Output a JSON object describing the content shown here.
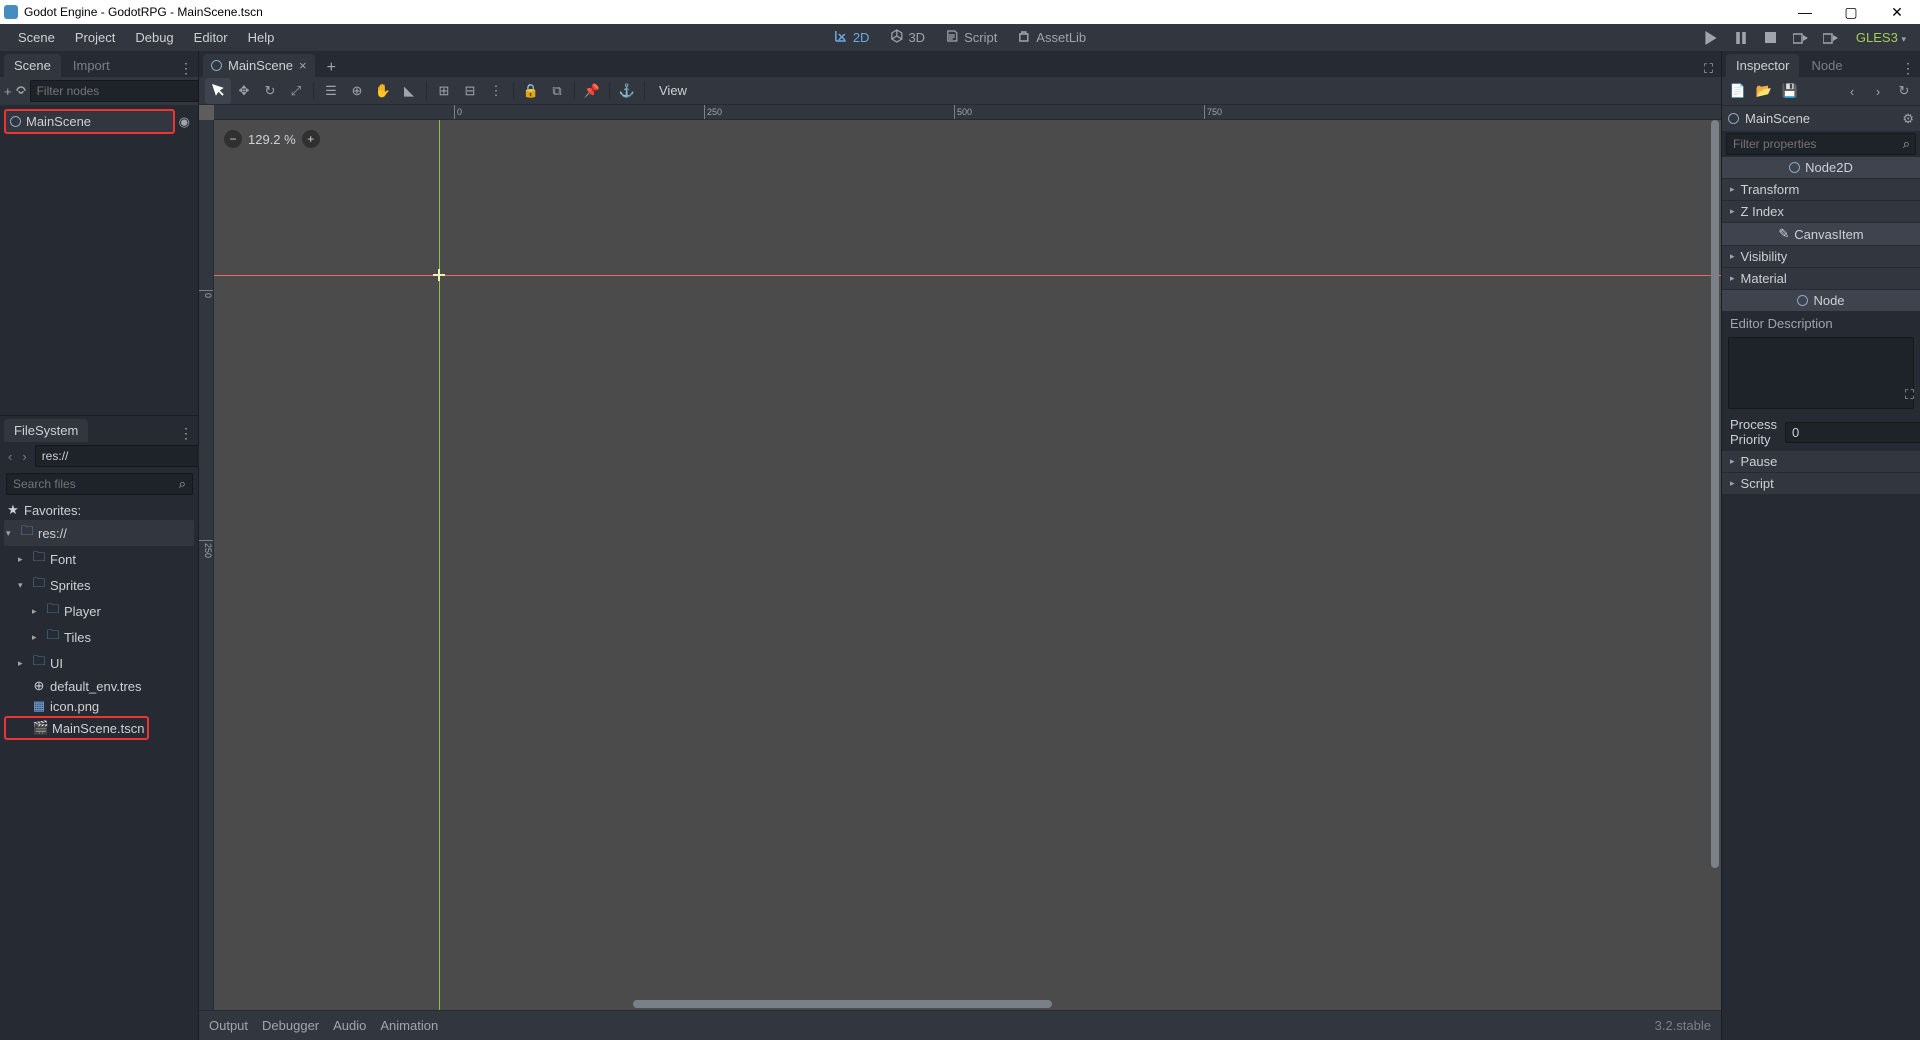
{
  "title": "Godot Engine - GodotRPG - MainScene.tscn",
  "menu": [
    "Scene",
    "Project",
    "Debug",
    "Editor",
    "Help"
  ],
  "center_tabs": [
    {
      "icon": "2d",
      "label": "2D",
      "active": true
    },
    {
      "icon": "3d",
      "label": "3D"
    },
    {
      "icon": "script",
      "label": "Script"
    },
    {
      "icon": "assetlib",
      "label": "AssetLib"
    }
  ],
  "renderer": "GLES3",
  "left": {
    "tabs": {
      "scene": "Scene",
      "import": "Import"
    },
    "filter_placeholder": "Filter nodes",
    "root_node": "MainScene"
  },
  "filesystem": {
    "title": "FileSystem",
    "path": "res://",
    "search_placeholder": "Search files",
    "favorites": "Favorites:",
    "tree": [
      {
        "type": "folder",
        "name": "res://",
        "open": true,
        "sel": true,
        "ind": 0
      },
      {
        "type": "folder",
        "name": "Font",
        "open": false,
        "ind": 1
      },
      {
        "type": "folder",
        "name": "Sprites",
        "open": true,
        "ind": 1
      },
      {
        "type": "folder",
        "name": "Player",
        "open": false,
        "ind": 2
      },
      {
        "type": "folder",
        "name": "Tiles",
        "open": false,
        "ind": 2
      },
      {
        "type": "folder",
        "name": "UI",
        "open": false,
        "ind": 1
      },
      {
        "type": "tres",
        "name": "default_env.tres",
        "ind": 1
      },
      {
        "type": "png",
        "name": "icon.png",
        "ind": 1
      },
      {
        "type": "tscn",
        "name": "MainScene.tscn",
        "ind": 1,
        "red": true
      }
    ]
  },
  "scene_tab": "MainScene",
  "view_label": "View",
  "zoom": "129.2 %",
  "ruler_ticks_h": [
    {
      "pos": 240,
      "label": "0"
    },
    {
      "pos": 490,
      "label": "250"
    },
    {
      "pos": 740,
      "label": "500"
    },
    {
      "pos": 990,
      "label": "750"
    }
  ],
  "ruler_ticks_v": [
    {
      "pos": 170,
      "label": "0"
    },
    {
      "pos": 420,
      "label": "250"
    }
  ],
  "bottom": {
    "items": [
      "Output",
      "Debugger",
      "Audio",
      "Animation"
    ],
    "version": "3.2.stable"
  },
  "inspector": {
    "tabs": {
      "inspector": "Inspector",
      "node": "Node"
    },
    "node_name": "MainScene",
    "filter_placeholder": "Filter properties",
    "classes": [
      {
        "name": "Node2D",
        "icon": "circle"
      },
      {
        "prop": "Transform"
      },
      {
        "prop": "Z Index"
      },
      {
        "name": "CanvasItem",
        "icon": "brush"
      },
      {
        "prop": "Visibility"
      },
      {
        "prop": "Material"
      },
      {
        "name": "Node",
        "icon": "circle"
      }
    ],
    "editor_desc": "Editor Description",
    "process_priority": {
      "label": "Process Priority",
      "value": "0"
    },
    "pause": "Pause",
    "script": "Script"
  }
}
